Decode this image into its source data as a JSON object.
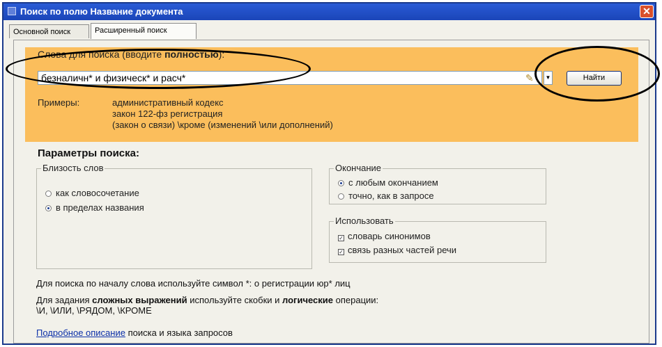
{
  "window": {
    "title": "Поиск по полю Название документа",
    "close_icon": "close-icon"
  },
  "tabs": [
    {
      "label": "Основной поиск",
      "active": false
    },
    {
      "label": "Расширенный поиск",
      "active": true
    }
  ],
  "search": {
    "words_label_prefix": "Слова для поиска (вводите ",
    "words_label_bold": "полностью",
    "words_label_suffix": "):",
    "query_value": "безналичн* и физическ* и расч*",
    "clear_icon": "broom-icon",
    "history_icon": "chevron-down-icon",
    "find_label": "Найти"
  },
  "examples": {
    "label": "Примеры:",
    "items": [
      "административный кодекс",
      "закон 122-фз регистрация",
      "(закон о связи) \\кроме (изменений \\или дополнений)"
    ]
  },
  "params": {
    "title": "Параметры поиска:",
    "proximity": {
      "legend": "Близость слов",
      "options": [
        {
          "label": "как словосочетание",
          "selected": false
        },
        {
          "label": "в пределах названия",
          "selected": true
        }
      ]
    },
    "ending": {
      "legend": "Окончание",
      "options": [
        {
          "label": "с любым окончанием",
          "selected": true
        },
        {
          "label": "точно, как в запросе",
          "selected": false
        }
      ]
    },
    "use": {
      "legend": "Использовать",
      "options": [
        {
          "label": "словарь синонимов",
          "checked": true
        },
        {
          "label": "связь разных частей речи",
          "checked": true
        }
      ]
    }
  },
  "notes": {
    "prefix_hint": "Для поиска по началу слова используйте символ *: о регистрации юр* лиц",
    "complex_1": "Для задания ",
    "complex_bold_1": "сложных выражений",
    "complex_2": " используйте скобки и ",
    "complex_bold_2": "логические",
    "complex_3": " операции:",
    "complex_ops": "\\И, \\ИЛИ, \\РЯДОМ, \\КРОМЕ",
    "link_text": "Подробное описание",
    "link_suffix": " поиска и языка запросов"
  },
  "colors": {
    "title_bar": "#1a45b8",
    "search_area": "#fbbe5c",
    "link": "#0b2fa8"
  }
}
